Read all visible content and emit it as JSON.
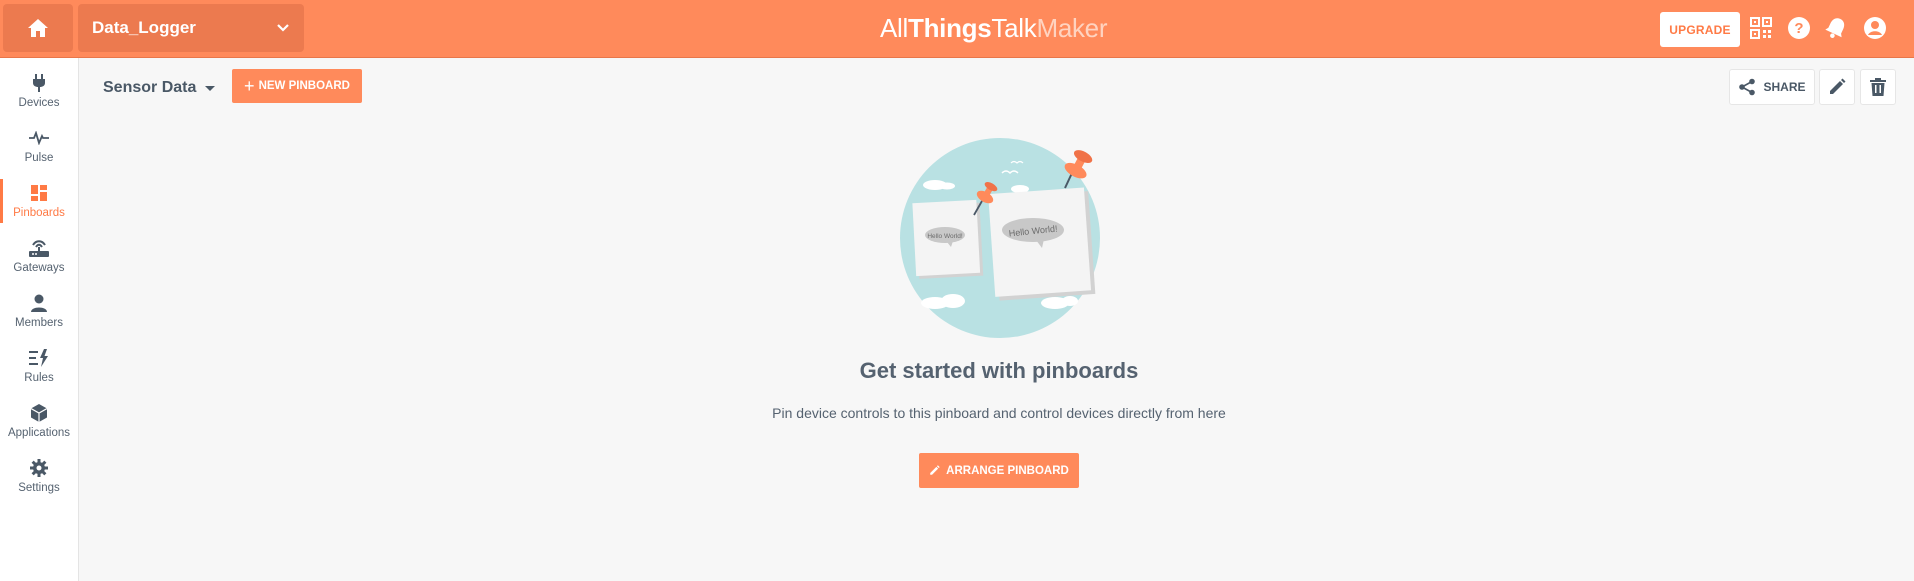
{
  "topbar": {
    "project_name": "Data_Logger",
    "logo": {
      "part1": "All",
      "part2": "Things",
      "part3": "Talk",
      "part4": "Maker"
    },
    "upgrade_label": "UPGRADE",
    "icons": [
      "home-icon",
      "chevron-down-icon",
      "qr-code-icon",
      "help-icon",
      "notifications-bell-icon",
      "user-account-icon"
    ]
  },
  "sidebar": {
    "items": [
      {
        "label": "Devices",
        "icon": "plug-icon"
      },
      {
        "label": "Pulse",
        "icon": "pulse-icon"
      },
      {
        "label": "Pinboards",
        "icon": "pinboards-icon",
        "active": true
      },
      {
        "label": "Gateways",
        "icon": "gateway-icon"
      },
      {
        "label": "Members",
        "icon": "person-icon"
      },
      {
        "label": "Rules",
        "icon": "rules-icon"
      },
      {
        "label": "Applications",
        "icon": "cube-icon"
      },
      {
        "label": "Settings",
        "icon": "gear-icon"
      }
    ]
  },
  "header": {
    "pinboard_name": "Sensor Data",
    "new_pinboard_label": "NEW PINBOARD",
    "share_label": "SHARE"
  },
  "empty_state": {
    "title": "Get started with pinboards",
    "description": "Pin device controls to this pinboard and control devices directly from here",
    "arrange_label": "ARRANGE PINBOARD",
    "note_small": "Hello World!",
    "note_large": "Hello World!"
  },
  "colors": {
    "accent": "#ff8a5b",
    "accent_dark": "#ec7a4f",
    "text": "#4a5866",
    "illustration_bg": "#b9e1e3"
  }
}
